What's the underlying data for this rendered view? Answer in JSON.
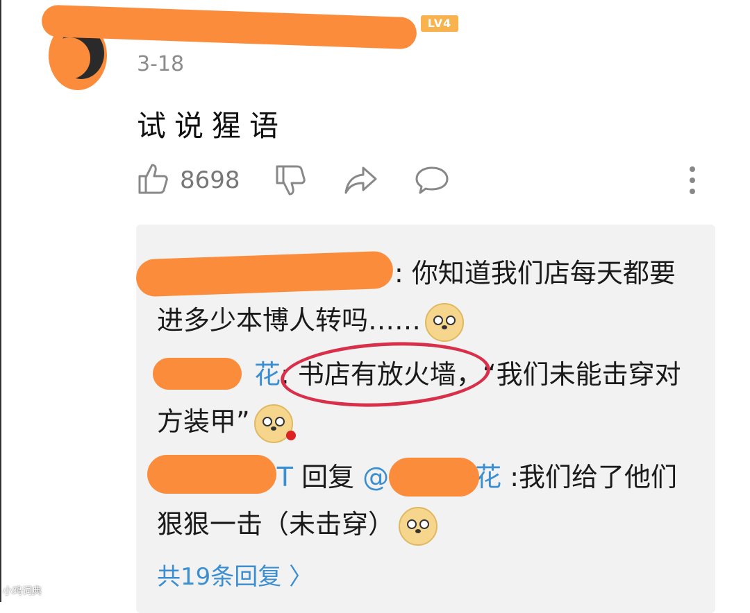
{
  "header": {
    "level_badge": "LV4",
    "date": "3-18"
  },
  "comment": {
    "text": "试说猩语"
  },
  "actions": {
    "like_count": "8698"
  },
  "replies": [
    {
      "name_suffix": "",
      "text": ": 你知道我们店每天都要进多少本博人转吗……"
    },
    {
      "name_suffix": "花",
      "text": ": 书店有放火墙，“我们未能击穿对方装甲”"
    },
    {
      "name_suffix": "T",
      "reply_word": " 回复 ",
      "at": "@",
      "target_suffix": "花",
      "text": " :我们给了他们狠狠一击（未击穿）"
    }
  ],
  "more_replies": "共19条回复 〉",
  "watermark": "小鸡词典",
  "colors": {
    "accent": "#3b8ed0",
    "redaction": "#fb8c3c",
    "annotation": "#d8304a"
  }
}
